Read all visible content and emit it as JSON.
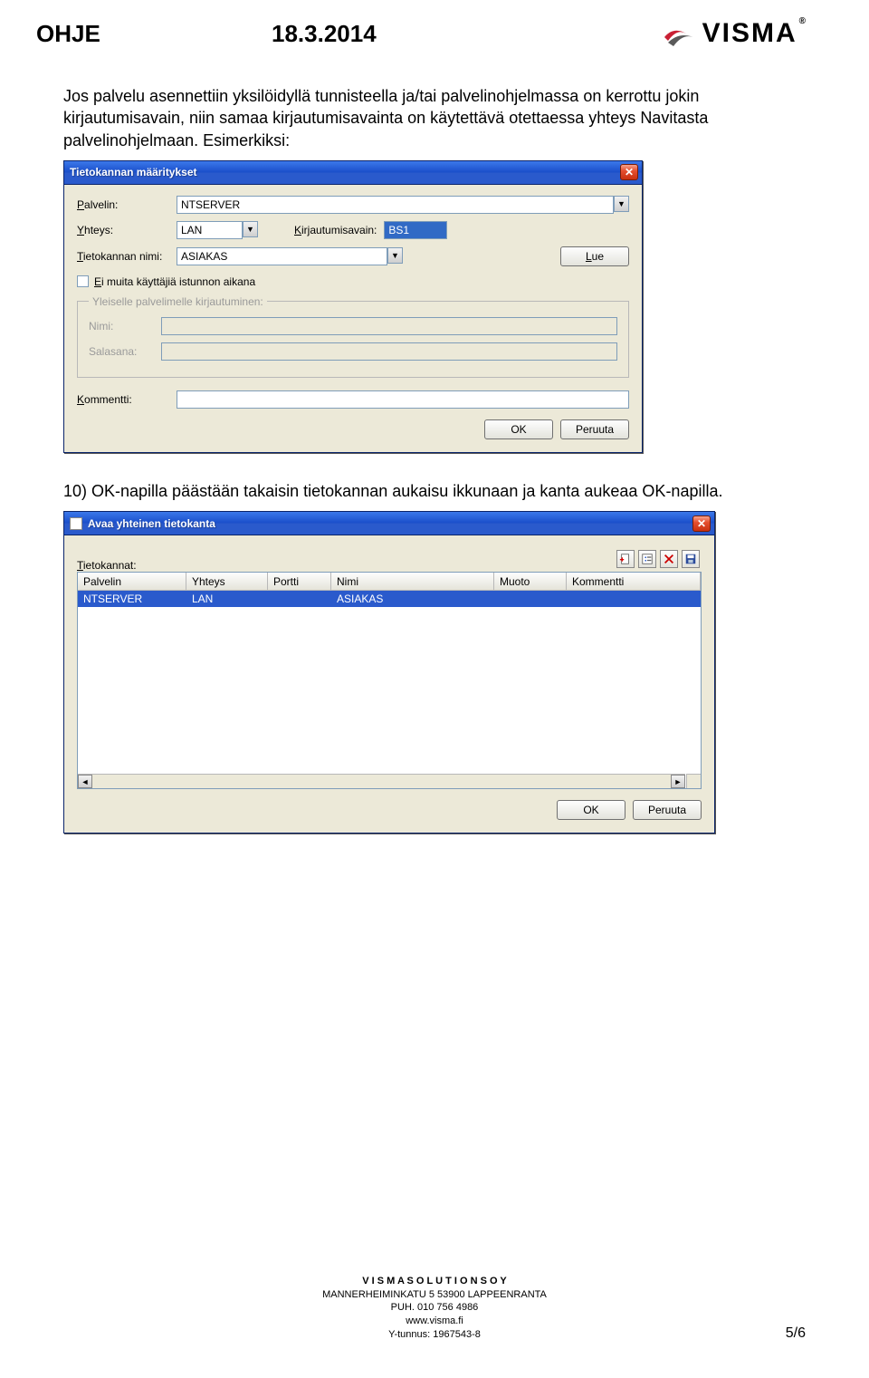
{
  "header": {
    "left": "OHJE",
    "date": "18.3.2014",
    "brand": "VISMA"
  },
  "paragraph1": "Jos palvelu asennettiin yksilöidyllä tunnisteella ja/tai palvelinohjelmassa on kerrottu jokin kirjautumisavain, niin samaa kirjautumisavainta on käytettävä otettaessa yhteys Navitasta palvelinohjelmaan. Esimerkiksi:",
  "dialog1": {
    "title": "Tietokannan määritykset",
    "labels": {
      "palvelin": "Palvelin:",
      "yhteys": "Yhteys:",
      "kirjautumisavain": "Kirjautumisavain:",
      "tietokannan_nimi": "Tietokannan nimi:",
      "ei_muita": "Ei muita käyttäjiä istunnon aikana",
      "group_legend": "Yleiselle palvelimelle kirjautuminen:",
      "nimi": "Nimi:",
      "salasana": "Salasana:",
      "kommentti": "Kommentti:"
    },
    "values": {
      "palvelin": "NTSERVER",
      "yhteys": "LAN",
      "kirjautumisavain": "BS1",
      "tietokannan_nimi": "ASIAKAS"
    },
    "buttons": {
      "lue": "Lue",
      "ok": "OK",
      "peruuta": "Peruuta"
    }
  },
  "paragraph2": "10) OK-napilla päästään takaisin tietokannan aukaisu ikkunaan ja kanta aukeaa OK-napilla.",
  "dialog2": {
    "title": "Avaa yhteinen tietokanta",
    "section_label": "Tietokannat:",
    "toolbar": {
      "new": "new-icon",
      "properties": "properties-icon",
      "delete": "delete-icon",
      "save": "save-icon"
    },
    "columns": [
      "Palvelin",
      "Yhteys",
      "Portti",
      "Nimi",
      "Muoto",
      "Kommentti"
    ],
    "row": {
      "palvelin": "NTSERVER",
      "yhteys": "LAN",
      "portti": "",
      "nimi": "ASIAKAS",
      "muoto": "",
      "kommentti": ""
    },
    "buttons": {
      "ok": "OK",
      "peruuta": "Peruuta"
    }
  },
  "footer": {
    "line1": "V I S M A  S O L U T I O N S  O Y",
    "line2": "MANNERHEIMINKATU 5   53900 LAPPEENRANTA",
    "line3": "PUH. 010 756 4986",
    "line4": "www.visma.fi",
    "line5": "Y-tunnus: 1967543-8"
  },
  "page_num": "5/6"
}
